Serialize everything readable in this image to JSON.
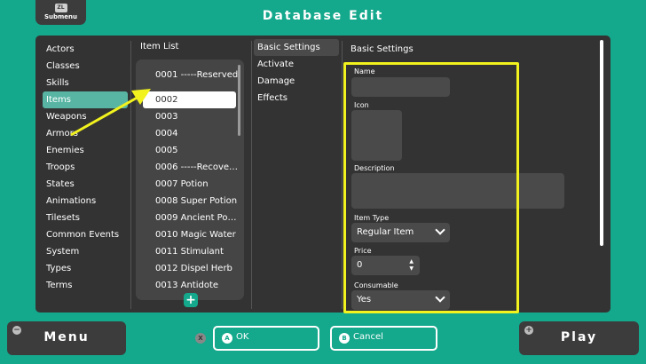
{
  "header": {
    "submenu_key": "ZL",
    "submenu_label": "Submenu",
    "title": "Database Edit"
  },
  "categories": [
    "Actors",
    "Classes",
    "Skills",
    "Items",
    "Weapons",
    "Armors",
    "Enemies",
    "Troops",
    "States",
    "Animations",
    "Tilesets",
    "Common Events",
    "System",
    "Types",
    "Terms"
  ],
  "active_category": "Items",
  "item_list": {
    "heading": "Item List",
    "items": [
      "0001 -----Reserved",
      "0002",
      "0003",
      "0004",
      "0005",
      "0006 -----Recove…",
      "0007 Potion",
      "0008 Super Potion",
      "0009 Ancient Po…",
      "0010 Magic Water",
      "0011 Stimulant",
      "0012 Dispel Herb",
      "0013 Antidote"
    ],
    "add_symbol": "+"
  },
  "tabs": [
    "Basic Settings",
    "Activate",
    "Damage",
    "Effects"
  ],
  "basic": {
    "heading": "Basic Settings",
    "name_label": "Name",
    "icon_label": "Icon",
    "description_label": "Description",
    "item_type_label": "Item Type",
    "item_type_value": "Regular Item",
    "price_label": "Price",
    "price_value": "0",
    "consumable_label": "Consumable",
    "consumable_value": "Yes"
  },
  "footer": {
    "menu_label": "Menu",
    "menu_icon": "−",
    "play_label": "Play",
    "play_icon": "+",
    "x_key": "X",
    "ok_key": "A",
    "ok_label": "OK",
    "cancel_key": "B",
    "cancel_label": "Cancel"
  },
  "colors": {
    "background": "#14a88c",
    "panel": "#333333",
    "highlight": "#f2f21e"
  }
}
